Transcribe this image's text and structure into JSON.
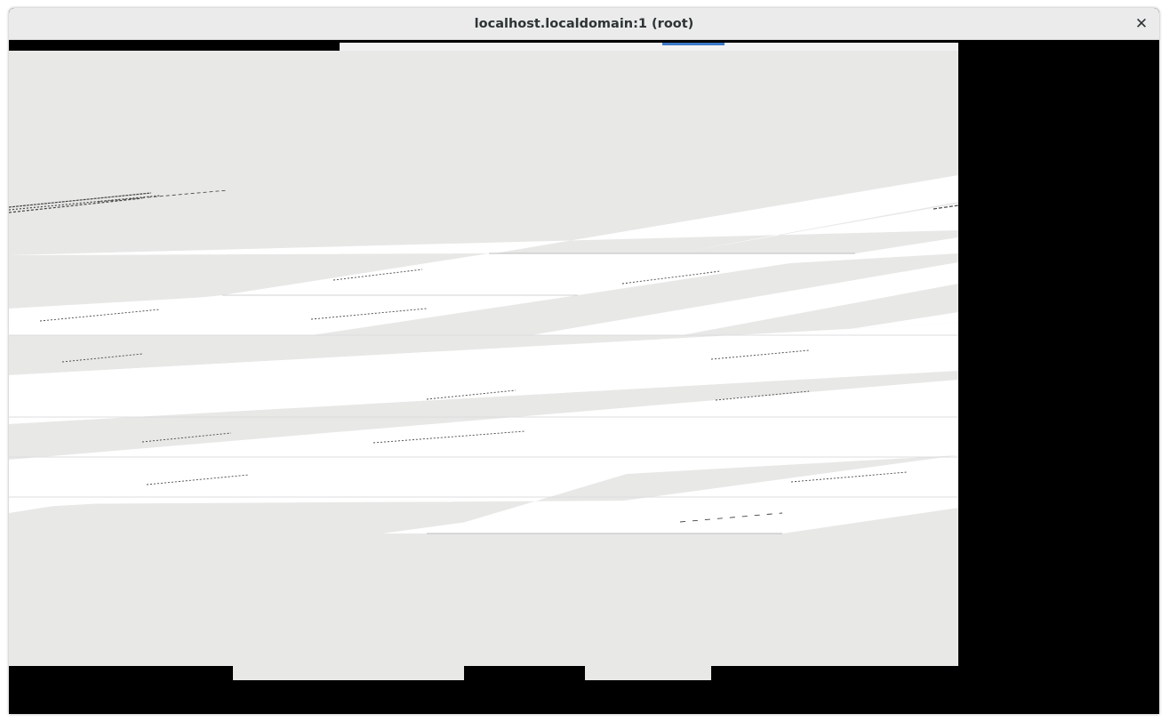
{
  "window": {
    "title": "localhost.localdomain:1 (root)",
    "close_glyph": "✕"
  },
  "icons": {
    "close": "close-icon"
  },
  "colors": {
    "titlebar": "#ebebeb",
    "canvas": "#e8e8e7",
    "frame": "#000000",
    "row": "#ffffff"
  }
}
